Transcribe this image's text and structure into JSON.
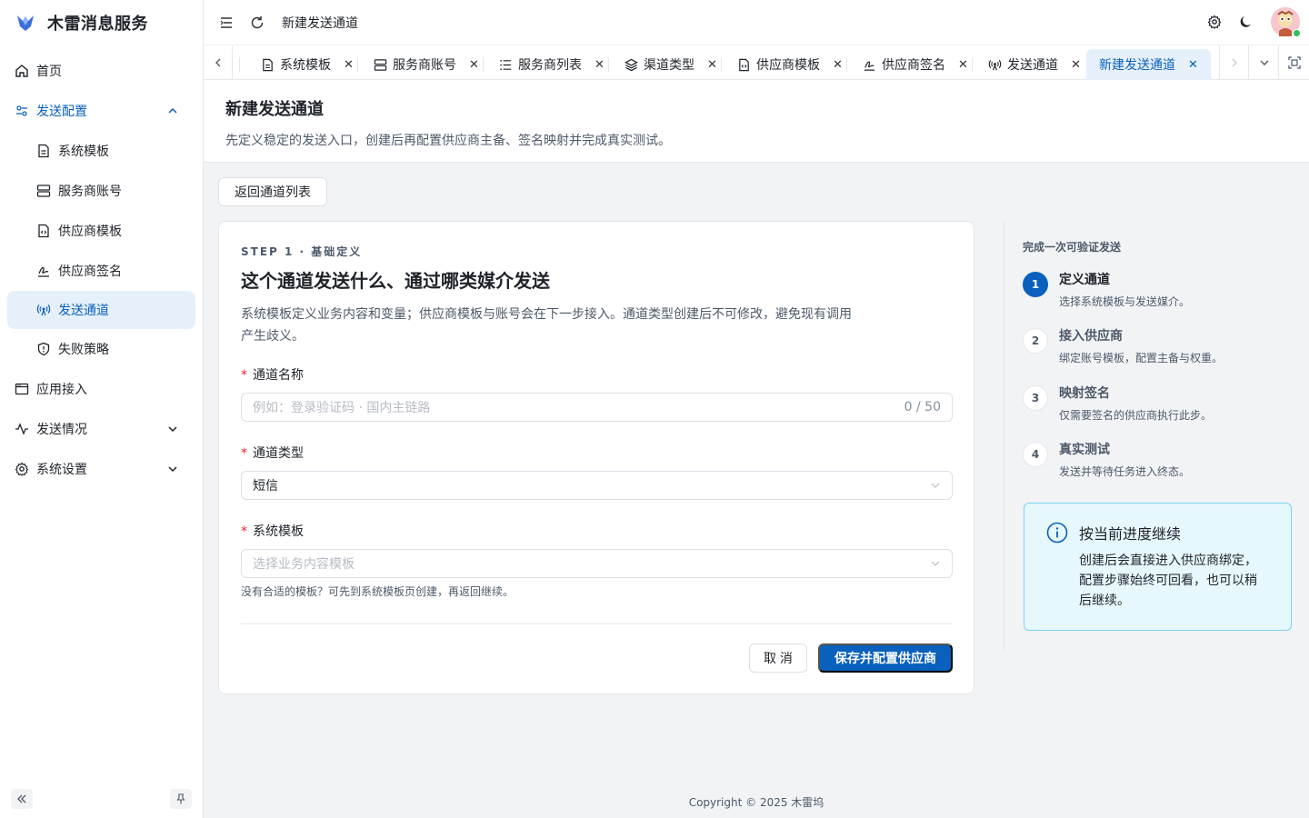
{
  "brand": {
    "title": "木雷消息服务"
  },
  "sidebar": {
    "items": [
      {
        "label": "首页"
      },
      {
        "label": "发送配置"
      },
      {
        "label": "系统模板"
      },
      {
        "label": "服务商账号"
      },
      {
        "label": "供应商模板"
      },
      {
        "label": "供应商签名"
      },
      {
        "label": "发送通道"
      },
      {
        "label": "失败策略"
      },
      {
        "label": "应用接入"
      },
      {
        "label": "发送情况"
      },
      {
        "label": "系统设置"
      }
    ]
  },
  "header": {
    "title": "新建发送通道"
  },
  "tabs": [
    {
      "label": "系统模板"
    },
    {
      "label": "服务商账号"
    },
    {
      "label": "服务商列表"
    },
    {
      "label": "渠道类型"
    },
    {
      "label": "供应商模板"
    },
    {
      "label": "供应商签名"
    },
    {
      "label": "发送通道"
    },
    {
      "label": "新建发送通道"
    }
  ],
  "page": {
    "title": "新建发送通道",
    "desc": "先定义稳定的发送入口，创建后再配置供应商主备、签名映射并完成真实测试。",
    "back_label": "返回通道列表"
  },
  "form": {
    "step_label": "STEP 1 · 基础定义",
    "title": "这个通道发送什么、通过哪类媒介发送",
    "desc": "系统模板定义业务内容和变量；供应商模板与账号会在下一步接入。通道类型创建后不可修改，避免现有调用产生歧义。",
    "name_label": "通道名称",
    "name_placeholder": "例如：登录验证码 · 国内主链路",
    "name_count": "0 / 50",
    "type_label": "通道类型",
    "type_value": "短信",
    "template_label": "系统模板",
    "template_placeholder": "选择业务内容模板",
    "template_hint": "没有合适的模板？可先到系统模板页创建，再返回继续。",
    "cancel_label": "取 消",
    "submit_label": "保存并配置供应商"
  },
  "steps": {
    "title": "完成一次可验证发送",
    "items": [
      {
        "num": "1",
        "name": "定义通道",
        "desc": "选择系统模板与发送媒介。"
      },
      {
        "num": "2",
        "name": "接入供应商",
        "desc": "绑定账号模板，配置主备与权重。"
      },
      {
        "num": "3",
        "name": "映射签名",
        "desc": "仅需要签名的供应商执行此步。"
      },
      {
        "num": "4",
        "name": "真实测试",
        "desc": "发送并等待任务进入终态。"
      }
    ],
    "info_title": "按当前进度继续",
    "info_text": "创建后会直接进入供应商绑定，配置步骤始终可回看，也可以稍后继续。"
  },
  "footer": {
    "text": "Copyright © 2025 木雷坞"
  },
  "colors": {
    "primary": "#0960bd",
    "active_bg": "#e6f0fb",
    "info_bg": "#e6f7fd"
  }
}
